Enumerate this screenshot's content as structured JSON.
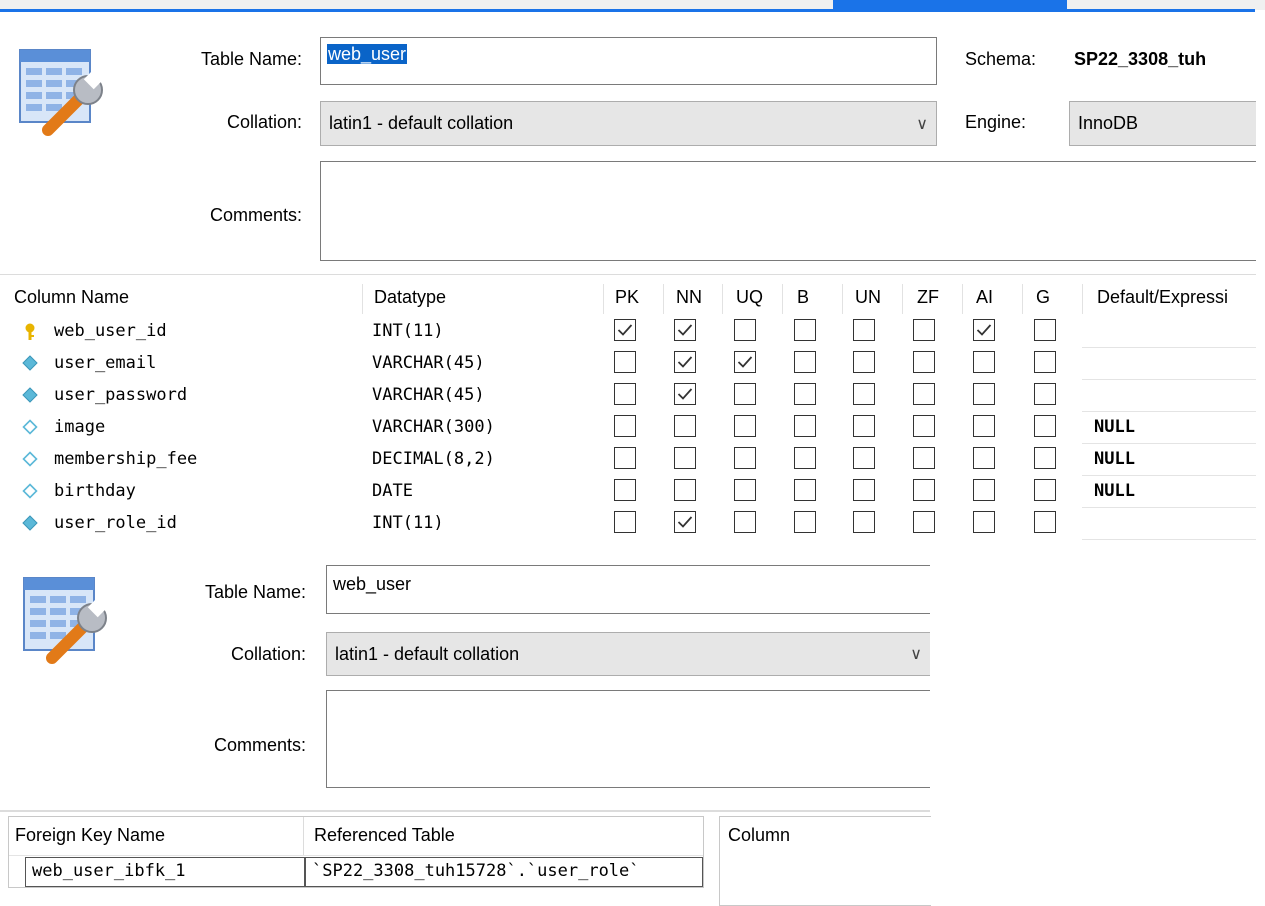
{
  "table1": {
    "table_name_label": "Table Name:",
    "table_name_value": "web_user",
    "schema_label": "Schema:",
    "schema_value": "SP22_3308_tuh",
    "collation_label": "Collation:",
    "collation_value": "latin1 - default collation",
    "engine_label": "Engine:",
    "engine_value": "InnoDB",
    "comments_label": "Comments:",
    "comments_value": ""
  },
  "columns_grid": {
    "headers": [
      "Column Name",
      "Datatype",
      "PK",
      "NN",
      "UQ",
      "B",
      "UN",
      "ZF",
      "AI",
      "G",
      "Default/Expressi"
    ],
    "rows": [
      {
        "name": "web_user_id",
        "icon": "primary-key-icon",
        "datatype": "INT(11)",
        "flags": [
          true,
          true,
          false,
          false,
          false,
          false,
          true,
          false
        ],
        "default": ""
      },
      {
        "name": "user_email",
        "icon": "not-null-column-icon",
        "datatype": "VARCHAR(45)",
        "flags": [
          false,
          true,
          true,
          false,
          false,
          false,
          false,
          false
        ],
        "default": ""
      },
      {
        "name": "user_password",
        "icon": "not-null-column-icon",
        "datatype": "VARCHAR(45)",
        "flags": [
          false,
          true,
          false,
          false,
          false,
          false,
          false,
          false
        ],
        "default": ""
      },
      {
        "name": "image",
        "icon": "nullable-column-icon",
        "datatype": "VARCHAR(300)",
        "flags": [
          false,
          false,
          false,
          false,
          false,
          false,
          false,
          false
        ],
        "default": "NULL"
      },
      {
        "name": "membership_fee",
        "icon": "nullable-column-icon",
        "datatype": "DECIMAL(8,2)",
        "flags": [
          false,
          false,
          false,
          false,
          false,
          false,
          false,
          false
        ],
        "default": "NULL"
      },
      {
        "name": "birthday",
        "icon": "nullable-column-icon",
        "datatype": "DATE",
        "flags": [
          false,
          false,
          false,
          false,
          false,
          false,
          false,
          false
        ],
        "default": "NULL"
      },
      {
        "name": "user_role_id",
        "icon": "not-null-column-icon",
        "datatype": "INT(11)",
        "flags": [
          false,
          true,
          false,
          false,
          false,
          false,
          false,
          false
        ],
        "default": ""
      }
    ]
  },
  "table2": {
    "table_name_label": "Table Name:",
    "table_name_value": "web_user",
    "collation_label": "Collation:",
    "collation_value": "latin1 - default collation",
    "comments_label": "Comments:",
    "comments_value": ""
  },
  "foreign_keys": {
    "header_name": "Foreign Key Name",
    "header_table": "Referenced Table",
    "header_column": "Column",
    "rows": [
      {
        "name": "web_user_ibfk_1",
        "referenced_table": "`SP22_3308_tuh15728`.`user_role`"
      }
    ]
  },
  "colors": {
    "accent": "#1a73e8",
    "selection": "#0a64c8",
    "key_icon": "#e8b400",
    "column_icon": "#5bb8d8"
  }
}
